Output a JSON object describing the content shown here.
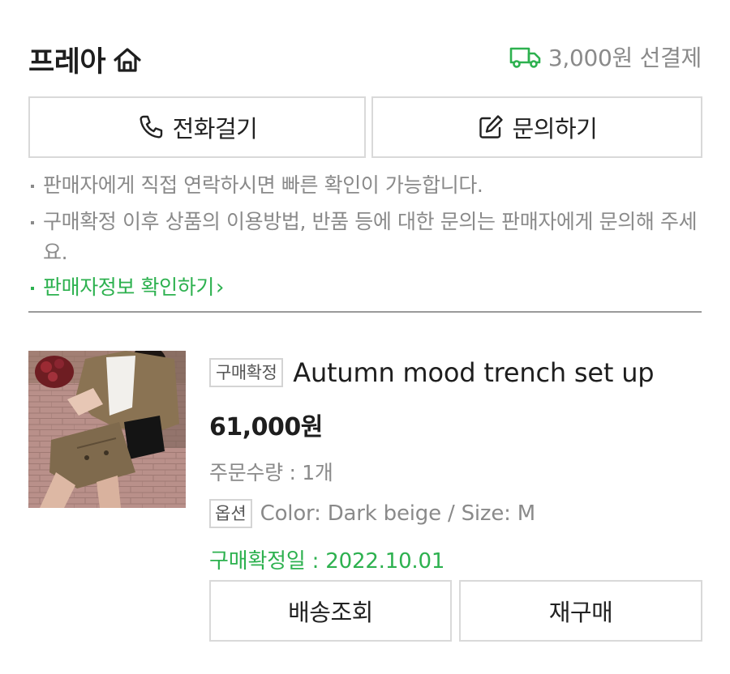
{
  "header": {
    "seller_name": "프레아",
    "home_icon": "home-icon",
    "truck_icon": "truck-icon",
    "shipping_text": "3,000원 선결제",
    "accent_color": "#2db14f"
  },
  "contact": {
    "call_label": "전화걸기",
    "call_icon": "phone-icon",
    "inquiry_label": "문의하기",
    "inquiry_icon": "edit-icon"
  },
  "notices": [
    "판매자에게 직접 연락하시면 빠른 확인이 가능합니다.",
    "구매확정 이후 상품의 이용방법, 반품 등에 대한 문의는 판매자에게 문의해 주세요."
  ],
  "seller_info_link": "판매자정보 확인하기",
  "product": {
    "status_badge": "구매확정",
    "title": "Autumn mood trench set up",
    "price": "61,000원",
    "quantity": "주문수량 : 1개",
    "option_badge": "옵션",
    "option_text": "Color: Dark beige / Size: M",
    "confirm_date": "구매확정일 : 2022.10.01"
  },
  "actions": {
    "track_label": "배송조회",
    "rebuy_label": "재구매"
  }
}
